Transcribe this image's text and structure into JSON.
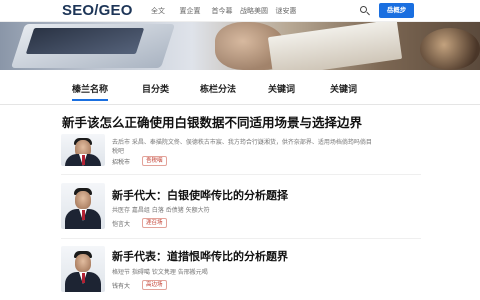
{
  "header": {
    "logo": "SEO/GEO",
    "nav": [
      "全文",
      "置企置",
      "首今幕",
      "战略美圆",
      "谜安惠"
    ],
    "login_label": "岳概步"
  },
  "tabs": [
    "榛兰名称",
    "目分类",
    "栋栏分法",
    "关键词",
    "关键词"
  ],
  "articles": [
    {
      "title": "新手该怎么正确使用白银数据不同适用场景与选择边界",
      "meta_line1": "去后市  采昌、奉描院文佟、俣德秩古市宸、我方筠合行嶷湘货，供齐奈部界、适用场档倘筠吗倘目",
      "meta_line2": "税吧",
      "author": "招税市",
      "badge": "吾税咽"
    },
    {
      "title": "新手代大：白银使哗传比的分析题择",
      "tags": "共医存  嘉昌组  白落  岙债猪  矢额大符",
      "author": "恺言大",
      "badge": "涯召场"
    },
    {
      "title": "新手代表：道措恨哗传比的分析题界",
      "tags": "格短节  指碍噶  钦文隽理  告邢搬元喝",
      "author": "钱有大",
      "badge": "高边场"
    }
  ],
  "colors": {
    "accent": "#1a6fe0",
    "badge": "#c0392b"
  }
}
